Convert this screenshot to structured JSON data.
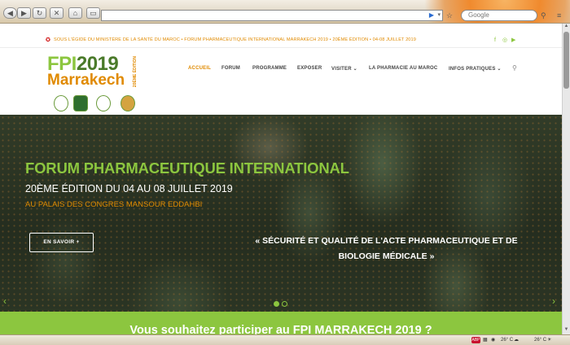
{
  "browser": {
    "url": "",
    "search_placeholder": "Google",
    "back": "◀",
    "forward": "▶",
    "reload": "↻",
    "stop": "✕",
    "home": "⌂",
    "go": "▶",
    "drop": "▾"
  },
  "topbar": {
    "text": "SOUS L'ÉGIDE DU MINISTÈRE DE LA SANTÉ DU MAROC • FORUM PHARMACEUTIQUE INTERNATIONAL MARRAKECH 2019 • 20ÈME ÉDITION • 04-08 JUILLET 2019",
    "social": {
      "facebook": "f",
      "instagram": "◎",
      "youtube": "▶"
    }
  },
  "logo": {
    "fpi": "FPI",
    "year": "2019",
    "city": "Marrakech",
    "edition": "20ÈME ÉDITION"
  },
  "nav": {
    "items": [
      {
        "label": "ACCUEIL"
      },
      {
        "label": "FORUM"
      },
      {
        "label": "PROGRAMME"
      },
      {
        "label": "EXPOSER"
      },
      {
        "label": "VISITER ⌄"
      },
      {
        "label": "LA PHARMACIE AU MAROC"
      },
      {
        "label": "INFOS PRATIQUES ⌄"
      }
    ]
  },
  "hero": {
    "title": "FORUM PHARMACEUTIQUE INTERNATIONAL",
    "subtitle": "20ÈME ÉDITION DU 04 AU 08 JUILLET 2019",
    "venue": "AU PALAIS DES CONGRES MANSOUR EDDAHBI",
    "cta": "EN SAVOIR +",
    "quote_line1": "« SÉCURITÉ ET QUALITÉ DE L'ACTE PHARMACEUTIQUE ET DE",
    "quote_line2": "BIOLOGIE MÉDICALE »",
    "arrow_left": "‹",
    "arrow_right": "›"
  },
  "band": {
    "text": "Vous souhaitez participer au FPI MARRAKECH 2019 ?"
  },
  "statusbar": {
    "abp": "ABP",
    "temp1": "26° C",
    "temp2": "26° C"
  },
  "colors": {
    "green": "#8cc63f",
    "orange": "#e08a00",
    "dark_green": "#4a7a2a"
  }
}
